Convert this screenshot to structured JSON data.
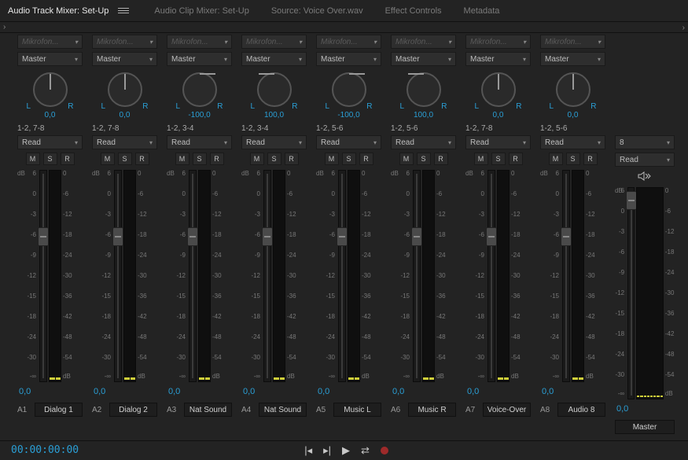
{
  "tabs": {
    "track_mixer": "Audio Track Mixer: Set-Up",
    "clip_mixer": "Audio Clip Mixer: Set-Up",
    "source": "Source: Voice Over.wav",
    "effect_controls": "Effect Controls",
    "metadata": "Metadata"
  },
  "common": {
    "input_placeholder": "Mikrofon...",
    "output": "Master",
    "read": "Read",
    "L": "L",
    "R": "R",
    "mute": "M",
    "solo": "S",
    "rec": "R",
    "db_label": "dB"
  },
  "fader_scale_left": [
    "6",
    "0",
    "-3",
    "-6",
    "-9",
    "-12",
    "-15",
    "-18",
    "-24",
    "-30",
    "-∞"
  ],
  "meter_scale_right": [
    "0",
    "-6",
    "-12",
    "-18",
    "-24",
    "-30",
    "-36",
    "-42",
    "-48",
    "-54",
    "dB"
  ],
  "tracks": [
    {
      "id": "A1",
      "name": "Dialog 1",
      "pan": "0,0",
      "pan_angle": "0",
      "io": "1-2, 7-8",
      "val": "0,0"
    },
    {
      "id": "A2",
      "name": "Dialog 2",
      "pan": "0,0",
      "pan_angle": "0",
      "io": "1-2, 7-8",
      "val": "0,0"
    },
    {
      "id": "A3",
      "name": "Nat Sound",
      "pan": "-100,0",
      "pan_angle": "-100",
      "io": "1-2, 3-4",
      "val": "0,0"
    },
    {
      "id": "A4",
      "name": "Nat Sound",
      "pan": "100,0",
      "pan_angle": "100",
      "io": "1-2, 3-4",
      "val": "0,0"
    },
    {
      "id": "A5",
      "name": "Music L",
      "pan": "-100,0",
      "pan_angle": "-100",
      "io": "1-2, 5-6",
      "val": "0,0"
    },
    {
      "id": "A6",
      "name": "Music R",
      "pan": "100,0",
      "pan_angle": "100",
      "io": "1-2, 5-6",
      "val": "0,0"
    },
    {
      "id": "A7",
      "name": "Voice-Over",
      "pan": "0,0",
      "pan_angle": "0",
      "io": "1-2, 7-8",
      "val": "0,0"
    },
    {
      "id": "A8",
      "name": "Audio 8",
      "pan": "0,0",
      "pan_angle": "0",
      "io": "1-2, 5-6",
      "val": "0,0"
    }
  ],
  "master": {
    "channels": "8",
    "read": "Read",
    "val": "0,0",
    "name": "Master"
  },
  "timecode": "00:00:00:00"
}
